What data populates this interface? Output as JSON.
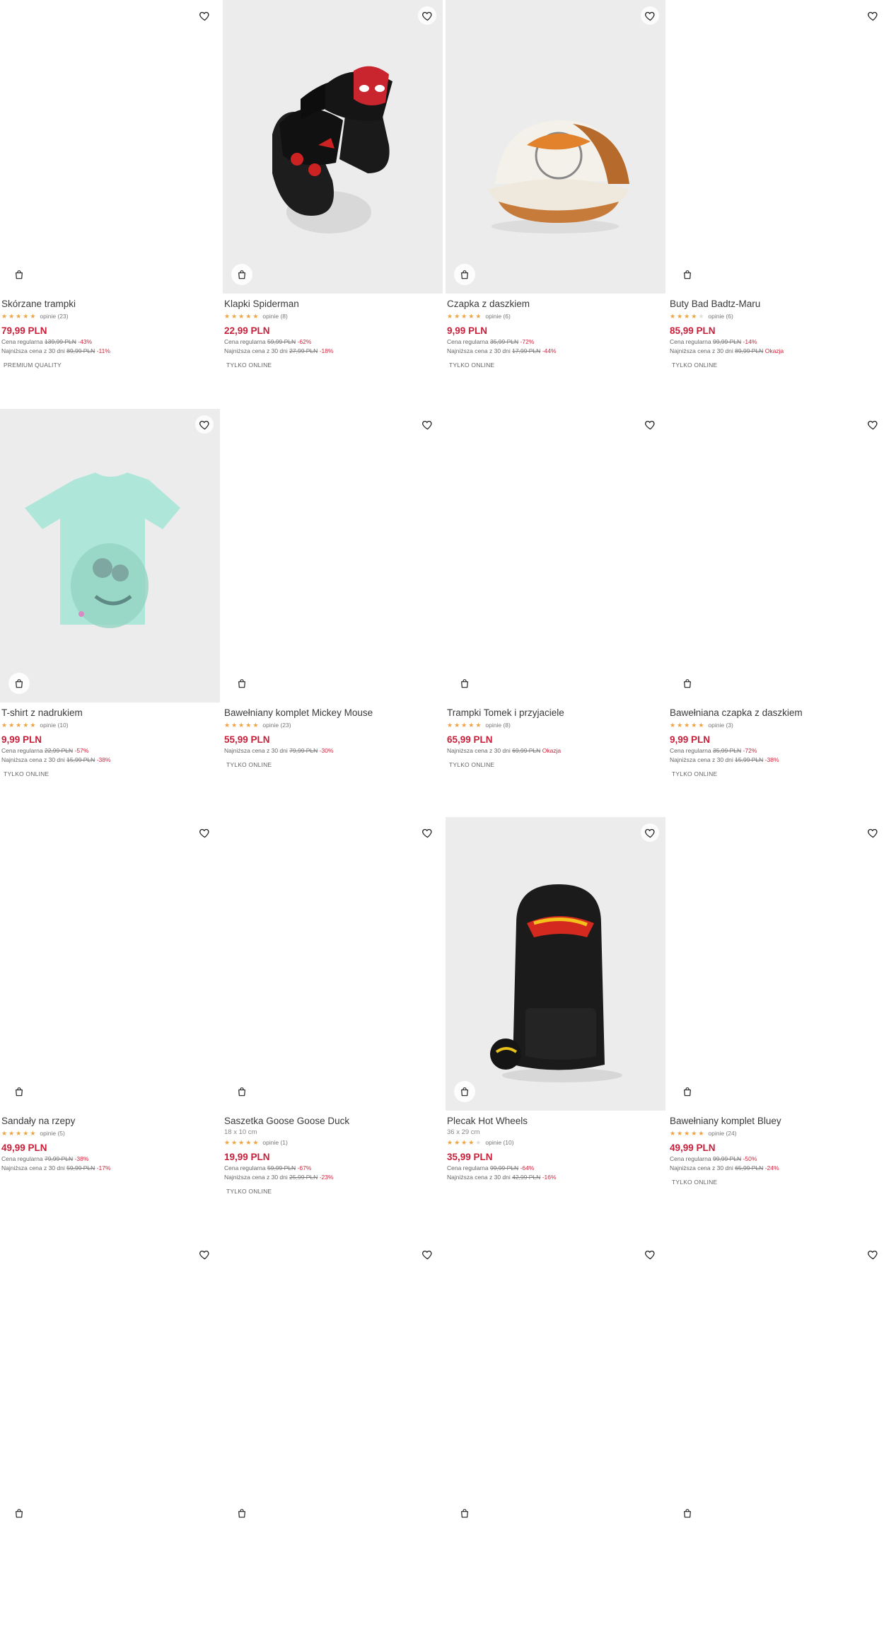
{
  "products": [
    {
      "name": "Skórzane trampki",
      "dims": "",
      "stars": 5,
      "reviews": "opinie (23)",
      "price": "79,99 PLN",
      "regular_label": "Cena regularna",
      "regular_price": "139,99 PLN",
      "regular_disc": "-43%",
      "lowest_label": "Najniższa cena z 30 dni",
      "lowest_price": "89,99 PLN",
      "lowest_disc": "-11%",
      "tag": "PREMIUM QUALITY",
      "image": ""
    },
    {
      "name": "Klapki Spiderman",
      "dims": "",
      "stars": 5,
      "reviews": "opinie (8)",
      "price": "22,99 PLN",
      "regular_label": "Cena regularna",
      "regular_price": "59,99 PLN",
      "regular_disc": "-62%",
      "lowest_label": "Najniższa cena z 30 dni",
      "lowest_price": "27,99 PLN",
      "lowest_disc": "-18%",
      "tag": "TYLKO ONLINE",
      "image": "slippers"
    },
    {
      "name": "Czapka z daszkiem",
      "dims": "",
      "stars": 5,
      "reviews": "opinie (6)",
      "price": "9,99 PLN",
      "regular_label": "Cena regularna",
      "regular_price": "35,99 PLN",
      "regular_disc": "-72%",
      "lowest_label": "Najniższa cena z 30 dni",
      "lowest_price": "17,99 PLN",
      "lowest_disc": "-44%",
      "tag": "TYLKO ONLINE",
      "image": "cap"
    },
    {
      "name": "Buty Bad Badtz-Maru",
      "dims": "",
      "stars": 4.5,
      "reviews": "opinie (6)",
      "price": "85,99 PLN",
      "regular_label": "Cena regularna",
      "regular_price": "99,99 PLN",
      "regular_disc": "-14%",
      "lowest_label": "Najniższa cena z 30 dni",
      "lowest_price": "89,99 PLN",
      "lowest_disc": "Okazja",
      "tag": "TYLKO ONLINE",
      "image": ""
    },
    {
      "name": "T-shirt z nadrukiem",
      "dims": "",
      "stars": 5,
      "reviews": "opinie (10)",
      "price": "9,99 PLN",
      "regular_label": "Cena regularna",
      "regular_price": "22,99 PLN",
      "regular_disc": "-57%",
      "lowest_label": "Najniższa cena z 30 dni",
      "lowest_price": "15,99 PLN",
      "lowest_disc": "-38%",
      "tag": "TYLKO ONLINE",
      "image": "tshirt"
    },
    {
      "name": "Bawełniany komplet Mickey Mouse",
      "dims": "",
      "stars": 5,
      "reviews": "opinie (23)",
      "price": "55,99 PLN",
      "regular_label": "",
      "regular_price": "",
      "regular_disc": "",
      "lowest_label": "Najniższa cena z 30 dni",
      "lowest_price": "79,99 PLN",
      "lowest_disc": "-30%",
      "tag": "TYLKO ONLINE",
      "image": ""
    },
    {
      "name": "Trampki Tomek i przyjaciele",
      "dims": "",
      "stars": 5,
      "reviews": "opinie (8)",
      "price": "65,99 PLN",
      "regular_label": "",
      "regular_price": "",
      "regular_disc": "",
      "lowest_label": "Najniższa cena z 30 dni",
      "lowest_price": "69,99 PLN",
      "lowest_disc": "Okazja",
      "tag": "TYLKO ONLINE",
      "image": ""
    },
    {
      "name": "Bawełniana czapka z daszkiem",
      "dims": "",
      "stars": 5,
      "reviews": "opinie (3)",
      "price": "9,99 PLN",
      "regular_label": "Cena regularna",
      "regular_price": "35,99 PLN",
      "regular_disc": "-72%",
      "lowest_label": "Najniższa cena z 30 dni",
      "lowest_price": "15,99 PLN",
      "lowest_disc": "-38%",
      "tag": "TYLKO ONLINE",
      "image": ""
    },
    {
      "name": "Sandały na rzepy",
      "dims": "",
      "stars": 5,
      "reviews": "opinie (5)",
      "price": "49,99 PLN",
      "regular_label": "Cena regularna",
      "regular_price": "79,99 PLN",
      "regular_disc": "-38%",
      "lowest_label": "Najniższa cena z 30 dni",
      "lowest_price": "59,99 PLN",
      "lowest_disc": "-17%",
      "tag": "",
      "image": ""
    },
    {
      "name": "Saszetka Goose Goose Duck",
      "dims": "18 x 10 cm",
      "stars": 5,
      "reviews": "opinie (1)",
      "price": "19,99 PLN",
      "regular_label": "Cena regularna",
      "regular_price": "59,99 PLN",
      "regular_disc": "-67%",
      "lowest_label": "Najniższa cena z 30 dni",
      "lowest_price": "25,99 PLN",
      "lowest_disc": "-23%",
      "tag": "TYLKO ONLINE",
      "image": ""
    },
    {
      "name": "Plecak Hot Wheels",
      "dims": "36 x 29 cm",
      "stars": 4.5,
      "reviews": "opinie (10)",
      "price": "35,99 PLN",
      "regular_label": "Cena regularna",
      "regular_price": "99,99 PLN",
      "regular_disc": "-64%",
      "lowest_label": "Najniższa cena z 30 dni",
      "lowest_price": "42,99 PLN",
      "lowest_disc": "-16%",
      "tag": "",
      "image": "backpack"
    },
    {
      "name": "Bawełniany komplet Bluey",
      "dims": "",
      "stars": 5,
      "reviews": "opinie (24)",
      "price": "49,99 PLN",
      "regular_label": "Cena regularna",
      "regular_price": "99,99 PLN",
      "regular_disc": "-50%",
      "lowest_label": "Najniższa cena z 30 dni",
      "lowest_price": "65,99 PLN",
      "lowest_disc": "-24%",
      "tag": "TYLKO ONLINE",
      "image": ""
    },
    {
      "name": "",
      "dims": "",
      "stars": 0,
      "reviews": "",
      "price": "",
      "regular_label": "",
      "regular_price": "",
      "regular_disc": "",
      "lowest_label": "",
      "lowest_price": "",
      "lowest_disc": "",
      "tag": "",
      "image": ""
    },
    {
      "name": "",
      "dims": "",
      "stars": 0,
      "reviews": "",
      "price": "",
      "regular_label": "",
      "regular_price": "",
      "regular_disc": "",
      "lowest_label": "",
      "lowest_price": "",
      "lowest_disc": "",
      "tag": "",
      "image": ""
    },
    {
      "name": "",
      "dims": "",
      "stars": 0,
      "reviews": "",
      "price": "",
      "regular_label": "",
      "regular_price": "",
      "regular_disc": "",
      "lowest_label": "",
      "lowest_price": "",
      "lowest_disc": "",
      "tag": "",
      "image": ""
    },
    {
      "name": "",
      "dims": "",
      "stars": 0,
      "reviews": "",
      "price": "",
      "regular_label": "",
      "regular_price": "",
      "regular_disc": "",
      "lowest_label": "",
      "lowest_price": "",
      "lowest_disc": "",
      "tag": "",
      "image": ""
    }
  ],
  "icons": {
    "favorite": "heart-icon",
    "cart": "shopping-bag-icon",
    "rating": "star-icon"
  },
  "colors": {
    "price": "#c8203a",
    "discount": "#d2253d",
    "star": "#f0a140"
  }
}
